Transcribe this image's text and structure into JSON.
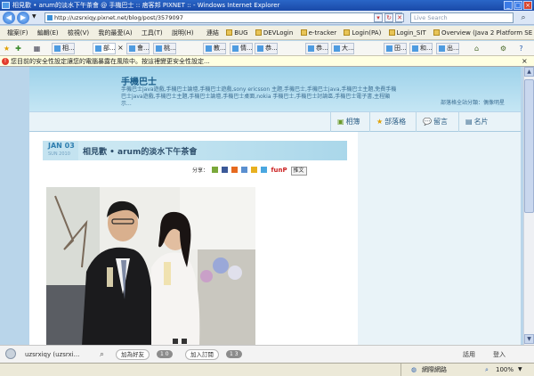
{
  "window": {
    "title": "相見歡 • arum的淡水下午茶會 @ 手機巴士 :: 痞客邦 PIXNET :: - Windows Internet Explorer"
  },
  "address": {
    "url": "http://uzsrxiqy.pixnet.net/blog/post/3579097",
    "search_placeholder": "Live Search"
  },
  "menu": {
    "items": [
      "檔案(F)",
      "編輯(E)",
      "檢視(V)",
      "我的最愛(A)",
      "工具(T)",
      "說明(H)"
    ],
    "links_label": "連結",
    "links": [
      "BUG",
      "DEVLogin",
      "e-tracker",
      "Login(PA)",
      "Login_SIT",
      "Overview (Java 2 Platform SE 5.0)"
    ]
  },
  "tabs": [
    "相...",
    "部...",
    "會...",
    "桃...",
    "教...",
    "情...",
    "恭...",
    "恭...",
    "大...",
    "田...",
    "和...",
    "出..."
  ],
  "infobar": {
    "text": "您目前的安全性設定讓您的電腦暴露在風險中。按這裡變更安全性設定..."
  },
  "blog": {
    "title": "手機巴士",
    "description": "手機巴士java遊戲,手機巴士論壇,手機巴士遊戲,sony ericsson 主題,手機巴士,手機巴士java,手機巴士主題,免費手機巴士java遊戲,手機巴士主題,手機巴士論壇,手機巴士桌面,nokia 手機巴士,手機巴士討論區,手機巴士電子書,主程顯示...",
    "author": "部落格全站分類：偶像明星",
    "nav": [
      "相簿",
      "部落格",
      "留言",
      "名片"
    ]
  },
  "post": {
    "date_month": "JAN 03",
    "date_sub": "SUN 2010",
    "title": "相見歡 • arum的淡水下午茶會",
    "share_label": "分享：",
    "funp_label": "funP",
    "push_label": "推文"
  },
  "bottombar": {
    "user": "uzsrxiqy (uzsrxi...",
    "add_friend": "加為好友",
    "friend_count": "1 0",
    "subscribe": "加入訂閱",
    "subscribe_count": "1 3",
    "chat": "話用",
    "login": "登入"
  },
  "statusbar": {
    "zone": "網際網路",
    "zoom": "100%"
  },
  "colors": {
    "accent": "#2d5f86",
    "titlebar": "#1a49a8",
    "header_bg": "#9ed2ea"
  }
}
